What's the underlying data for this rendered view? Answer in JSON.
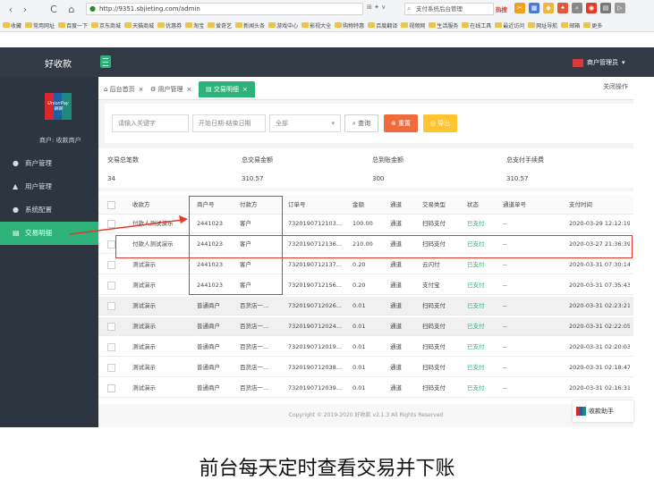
{
  "browser": {
    "nav_back": "‹",
    "nav_forward": "›",
    "nav_reload": "C",
    "nav_home": "⌂",
    "address": "http://9351.sbjieting.com/admin",
    "addr_tools": "⊞ ✦ ∨",
    "search": "支付系统后台管理",
    "hot": "热搜",
    "bookmarks": [
      "收藏",
      "常用网址",
      "百度一下",
      "京东商城",
      "天猫商城",
      "优惠券",
      "淘宝",
      "爱奇艺",
      "新闻头条",
      "游戏中心",
      "影视大全",
      "购物特惠",
      "百度翻译",
      "视频网",
      "生活服务",
      "在线工具",
      "最近访问",
      "网址导航",
      "邮箱",
      "更多"
    ]
  },
  "header": {
    "brand": "好收款",
    "user": "商户管理员"
  },
  "sidebar": {
    "logo_text": "UnionPay 银联",
    "merchant": "商户: 收款商户",
    "items": [
      {
        "label": "商户管理",
        "icon": "●"
      },
      {
        "label": "用户管理",
        "icon": "▲"
      },
      {
        "label": "系统配置",
        "icon": "●"
      },
      {
        "label": "交易明细",
        "icon": "▤"
      }
    ]
  },
  "tabs": {
    "items": [
      "后台首页",
      "用户管理",
      "交易明细"
    ],
    "close_ops": "关闭操作"
  },
  "filter": {
    "keyword_placeholder": "请输入关键字",
    "date_placeholder": "开始日期-结束日期",
    "select_value": "全部",
    "search_btn": "查询",
    "reset_btn": "重置",
    "export_btn": "导出"
  },
  "summary": {
    "labels": [
      "交易总笔数",
      "总交易金额",
      "总到账金额",
      "总支付手续费"
    ],
    "values": [
      "34",
      "310.57",
      "300",
      "310.57"
    ]
  },
  "table": {
    "headers": [
      "收款方",
      "商户号",
      "付款方",
      "订单号",
      "金额",
      "通道",
      "交易类型",
      "状态",
      "通道单号",
      "支付时间"
    ],
    "rows": [
      [
        "付款人测试演示",
        "2441023",
        "客户",
        "7320190712103...",
        "100.00",
        "通道",
        "扫码支付",
        "已支付",
        "--",
        "2020-03-29 12:12:19"
      ],
      [
        "付款人测试演示",
        "2441023",
        "客户",
        "7320190712136...",
        "210.00",
        "通道",
        "扫码支付",
        "已支付",
        "--",
        "2020-03-27 21:36:39"
      ],
      [
        "测试演示",
        "2441023",
        "客户",
        "7320190712137...",
        "0.20",
        "通道",
        "云闪付",
        "已支付",
        "--",
        "2020-03-31 07:30:14"
      ],
      [
        "测试演示",
        "2441023",
        "客户",
        "7320190712156...",
        "0.20",
        "通道",
        "支付宝",
        "已支付",
        "--",
        "2020-03-31 07:35:43"
      ],
      [
        "测试演示",
        "普通商户",
        "百货店一...",
        "7320190712026...",
        "0.01",
        "通道",
        "扫码支付",
        "已支付",
        "--",
        "2020-03-31 02:23:21"
      ],
      [
        "测试演示",
        "普通商户",
        "百货店一...",
        "7320190712024...",
        "0.01",
        "通道",
        "扫码支付",
        "已支付",
        "--",
        "2020-03-31 02:22:05"
      ],
      [
        "测试演示",
        "普通商户",
        "百货店一...",
        "7320190712019...",
        "0.01",
        "通道",
        "扫码支付",
        "已支付",
        "--",
        "2020-03-31 02:20:03"
      ],
      [
        "测试演示",
        "普通商户",
        "百货店一...",
        "7320190712038...",
        "0.01",
        "通道",
        "扫码支付",
        "已支付",
        "--",
        "2020-03-31 02:18:47"
      ],
      [
        "测试演示",
        "普通商户",
        "百货店一...",
        "7320190712039...",
        "0.01",
        "通道",
        "扫码支付",
        "已支付",
        "--",
        "2020-03-31 02:16:31"
      ]
    ]
  },
  "footer": "Copyright © 2019-2020 好收款 v2.1.3 All Rights Reserved",
  "support": "收款助手",
  "caption": "前台每天定时查看交易并下账",
  "colors": {
    "accent": "#2fb27a",
    "annotation": "#e23b2c",
    "sidebar": "#2d3540"
  }
}
